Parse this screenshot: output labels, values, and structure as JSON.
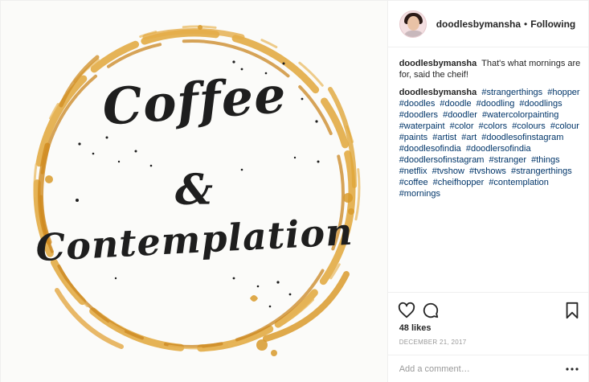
{
  "post": {
    "artwork": {
      "line1": "Coffee",
      "line2": "&",
      "line3": "Contemplation",
      "ring_color": "#d99a2b",
      "ink_color": "#1e1e1e"
    },
    "header": {
      "username": "doodlesbymansha",
      "separator": "•",
      "follow_label": "Following",
      "avatar_icon": "profile-photo-icon"
    },
    "comments": [
      {
        "username": "doodlesbymansha",
        "text": "That's what mornings are for, said the cheif!"
      },
      {
        "username": "doodlesbymansha",
        "tags": [
          "#strangerthings",
          "#hopper",
          "#doodles",
          "#doodle",
          "#doodling",
          "#doodlings",
          "#doodlers",
          "#doodler",
          "#watercolorpainting",
          "#waterpaint",
          "#color",
          "#colors",
          "#colours",
          "#colour",
          "#paints",
          "#artist",
          "#art",
          "#doodlesofinstagram",
          "#doodlesofindia",
          "#doodlersofindia",
          "#doodlersofinstagram",
          "#stranger",
          "#things",
          "#netflix",
          "#tvshow",
          "#tvshows",
          "#strangerthings",
          "#coffee",
          "#cheifhopper",
          "#contemplation",
          "#mornings"
        ]
      }
    ],
    "actions": {
      "like_icon": "heart-icon",
      "comment_icon": "comment-bubble-icon",
      "save_icon": "bookmark-icon"
    },
    "likes": "48 likes",
    "date": "DECEMBER 21, 2017",
    "add_comment": {
      "placeholder": "Add a comment…",
      "more_icon": "ellipsis-icon"
    },
    "colors": {
      "hashtag": "#003569",
      "text": "#262626",
      "muted": "#999999",
      "border": "#efefef"
    }
  }
}
